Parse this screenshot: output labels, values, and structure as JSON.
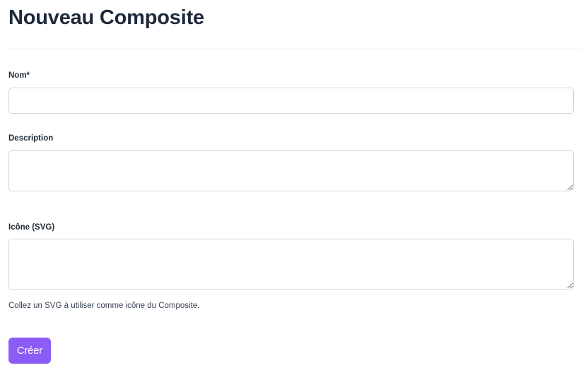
{
  "header": {
    "title": "Nouveau Composite"
  },
  "form": {
    "name": {
      "label": "Nom*",
      "value": "",
      "placeholder": ""
    },
    "description": {
      "label": "Description",
      "value": "",
      "placeholder": ""
    },
    "icon_svg": {
      "label": "Icône (SVG)",
      "value": "",
      "placeholder": "",
      "help": "Collez un SVG à utiliser comme icône du Composite."
    },
    "submit_label": "Créer"
  },
  "colors": {
    "accent": "#8b5cf6",
    "title": "#1e293b",
    "border": "#d1d5db"
  }
}
